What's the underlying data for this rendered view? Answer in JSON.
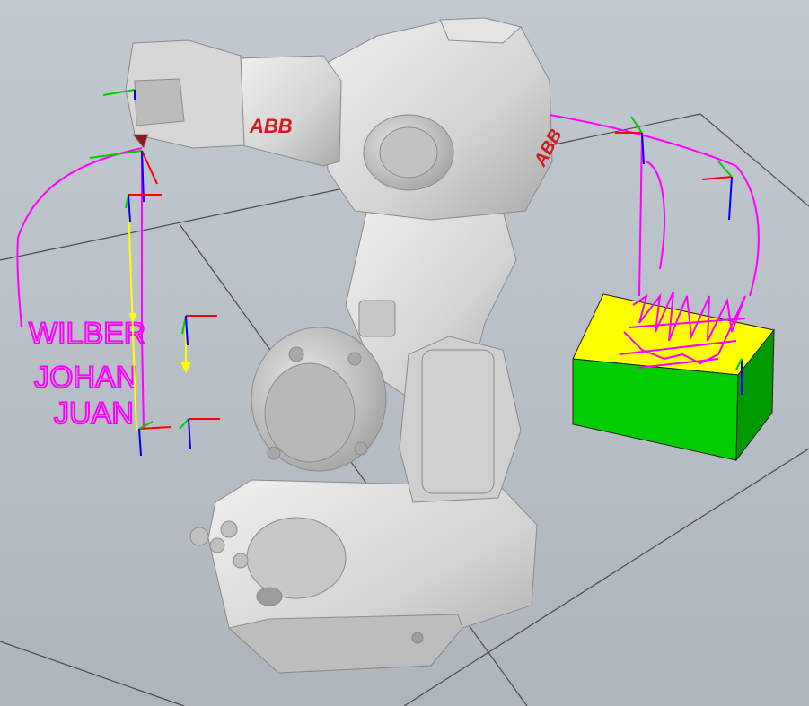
{
  "robot": {
    "brand_logo": "ABB",
    "body_color": "#d9d9d9",
    "shadow_color": "#9a9a9a",
    "logo_color": "#cc1e1e"
  },
  "scene": {
    "background_top": "#bfc5cc",
    "background_bottom": "#aab1b9",
    "floor_line_color": "#4a4a4a",
    "path_color": "#ff00ff",
    "guide_path_color": "#ffff00",
    "axis_colors": {
      "x": "#ff0000",
      "y": "#00cc00",
      "z": "#0000ff"
    }
  },
  "workpiece": {
    "top_color": "#ffff00",
    "front_color": "#00cc00",
    "side_color": "#00a000"
  },
  "handwriting": {
    "left": [
      "WILBER",
      "JOHAN",
      "JUAN"
    ]
  }
}
